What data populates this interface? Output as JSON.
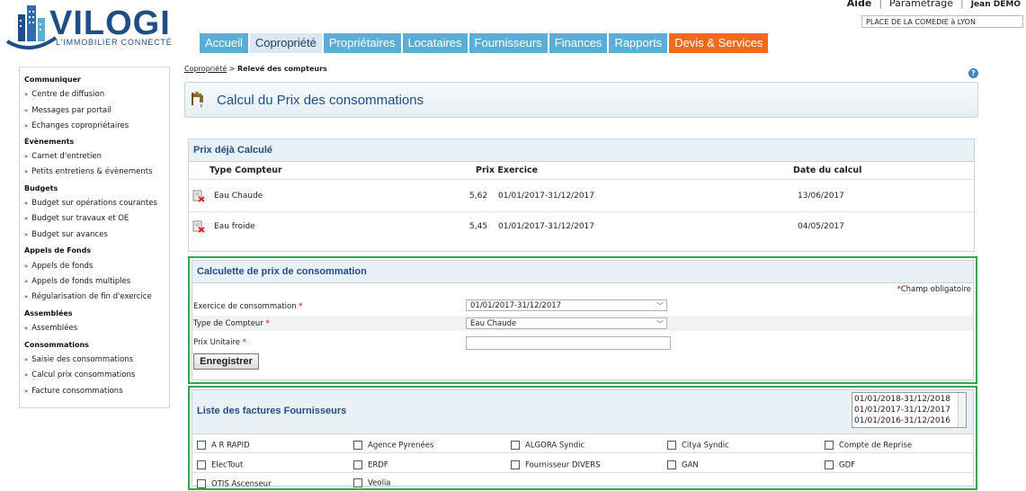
{
  "brand": {
    "name": "VILOGI",
    "tagline": "L'IMMOBILIER CONNECTÉ"
  },
  "toplinks": {
    "aide": "Aide",
    "parametrage": "Paramétrage",
    "user": "Jean DEMO"
  },
  "residence": "PLACE DE LA COMEDIE à LYON",
  "tabs": [
    {
      "label": "Accueil"
    },
    {
      "label": "Copropriété"
    },
    {
      "label": "Propriétaires"
    },
    {
      "label": "Locataires"
    },
    {
      "label": "Fournisseurs"
    },
    {
      "label": "Finances"
    },
    {
      "label": "Rapports"
    },
    {
      "label": "Devis & Services"
    }
  ],
  "sidebar": {
    "communiquer": {
      "title": "Communiquer",
      "items": [
        "Centre de diffusion",
        "Messages par portail",
        "Echanges copropriétaires"
      ]
    },
    "evenements": {
      "title": "Évènements",
      "items": [
        "Carnet d'entretien",
        "Petits entretiens & évènements"
      ]
    },
    "budgets": {
      "title": "Budgets",
      "items": [
        "Budget sur opérations courantes",
        "Budget sur travaux et OE",
        "Budget sur avances"
      ]
    },
    "appels": {
      "title": "Appels de Fonds",
      "items": [
        "Appels de fonds",
        "Appels de fonds multiples",
        "Régularisation de fin d'exercice"
      ]
    },
    "assemblees": {
      "title": "Assemblées",
      "items": [
        "Assemblées"
      ]
    },
    "consommations": {
      "title": "Consommations",
      "items": [
        "Saisie des consommations",
        "Calcul prix consommations",
        "Facture consommations"
      ]
    }
  },
  "breadcrumb": {
    "parent": "Copropriété",
    "sep": " > ",
    "current": "Relevé des compteurs"
  },
  "page": {
    "title": "Calcul du Prix des consommations"
  },
  "prix": {
    "title": "Prix déjà Calculé",
    "headers": {
      "type": "Type Compteur",
      "prix": "Prix Exercice",
      "date": "Date du calcul"
    },
    "rows": [
      {
        "type": "Eau Chaude",
        "prix": "5,62",
        "exercice": "01/01/2017-31/12/2017",
        "date": "13/06/2017"
      },
      {
        "type": "Eau froide",
        "prix": "5,45",
        "exercice": "01/01/2017-31/12/2017",
        "date": "04/05/2017"
      }
    ]
  },
  "calc": {
    "title": "Calculette de prix de consommation",
    "required_star": "*",
    "required_note": "Champ obligatoire",
    "exercice_label": "Exercice de consommation",
    "exercice_value": "01/01/2017-31/12/2017",
    "type_label": "Type de Compteur",
    "type_value": "Eau Chaude",
    "prix_label": "Prix Unitaire",
    "prix_value": "",
    "save": "Enregistrer"
  },
  "fournisseurs": {
    "title": "Liste des factures Fournisseurs",
    "exercices": [
      "01/01/2018-31/12/2018",
      "01/01/2017-31/12/2017",
      "01/01/2016-31/12/2016"
    ],
    "items": [
      "A R RAPID",
      "Agence Pyrenées",
      "ALGORA Syndic",
      "Citya Syndic",
      "Compte de Reprise",
      "ElecTout",
      "ERDF",
      "Fournisseur DIVERS",
      "GAN",
      "GDF",
      "OTIS Ascenseur",
      "Veolia"
    ]
  }
}
